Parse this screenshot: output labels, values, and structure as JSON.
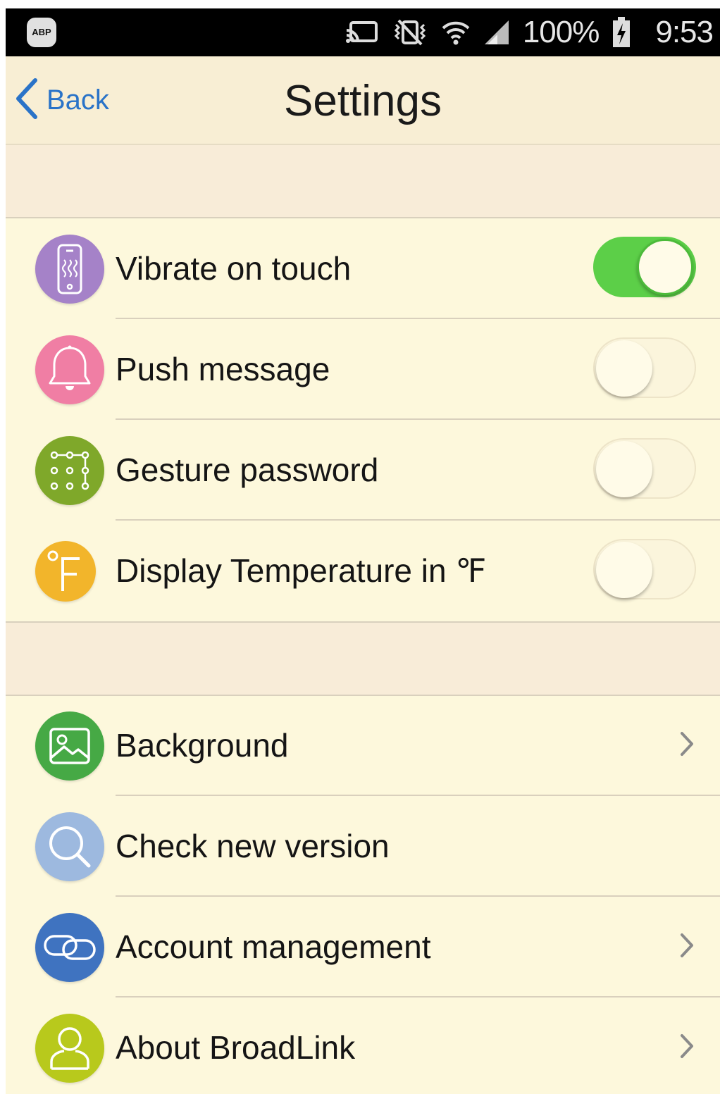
{
  "status_bar": {
    "abp_badge": "ABP",
    "icons": [
      "cast-icon",
      "vibrate-mute-icon",
      "wifi-icon",
      "signal-icon",
      "battery-charging-icon"
    ],
    "battery": "100%",
    "time": "9:53"
  },
  "header": {
    "back_label": "Back",
    "title": "Settings",
    "accent_color": "#2a73c8"
  },
  "toggles": [
    {
      "label": "Vibrate on touch",
      "icon": "vibrate-phone-icon",
      "icon_color": "#a582c8",
      "enabled": true
    },
    {
      "label": "Push message",
      "icon": "bell-icon",
      "icon_color": "#f07ea4",
      "enabled": false
    },
    {
      "label": "Gesture password",
      "icon": "pattern-lock-icon",
      "icon_color": "#7fa82a",
      "enabled": false
    },
    {
      "label": "Display Temperature in ℉",
      "icon": "fahrenheit-icon",
      "icon_color": "#f2b52b",
      "enabled": false
    }
  ],
  "links": [
    {
      "label": "Background",
      "icon": "image-icon",
      "icon_color": "#46a945",
      "chevron": true
    },
    {
      "label": "Check new version",
      "icon": "search-icon",
      "icon_color": "#9db9df",
      "chevron": false
    },
    {
      "label": "Account management",
      "icon": "link-icon",
      "icon_color": "#3f73c0",
      "chevron": true
    },
    {
      "label": "About BroadLink",
      "icon": "user-icon",
      "icon_color": "#b8c91c",
      "chevron": true
    }
  ],
  "toggle_on_color": "#5ccf48"
}
